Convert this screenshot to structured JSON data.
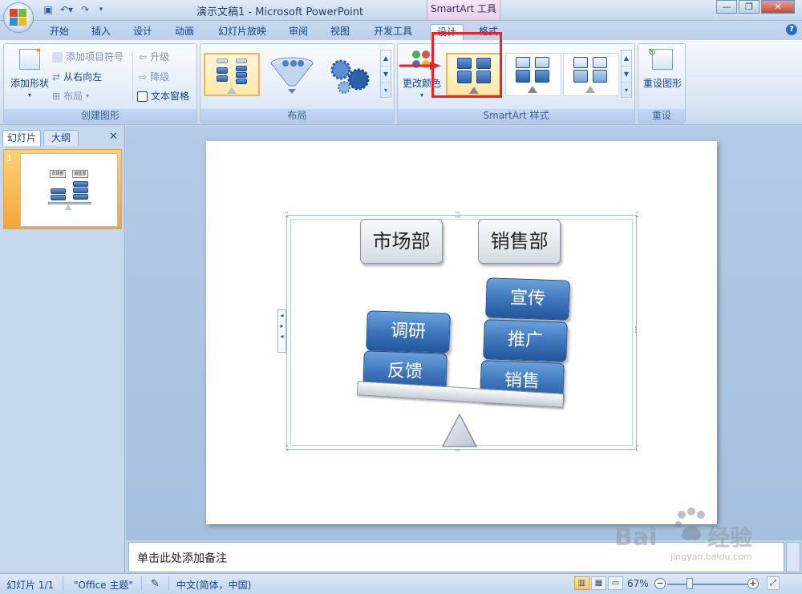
{
  "window": {
    "title": "演示文稿1 - Microsoft PowerPoint",
    "context_tab": "SmartArt 工具",
    "buttons": {
      "minimize": "—",
      "restore": "❐",
      "close": "✕"
    }
  },
  "qat": {
    "save_icon": "save-icon",
    "undo_icon": "undo-icon",
    "redo_icon": "redo-icon"
  },
  "tabs": [
    "开始",
    "插入",
    "设计",
    "动画",
    "幻灯片放映",
    "审阅",
    "视图",
    "开发工具",
    "设计",
    "格式"
  ],
  "active_tab_index": 8,
  "ribbon": {
    "create_group": {
      "label": "创建图形",
      "add_shape": "添加形状",
      "add_bullet": "添加项目符号",
      "right_to_left": "从右向左",
      "layout": "布局",
      "promote": "升级",
      "demote": "降级",
      "text_pane": "文本窗格"
    },
    "layouts_group": {
      "label": "布局"
    },
    "styles_group": {
      "label": "SmartArt 样式",
      "change_colors": "更改颜色"
    },
    "reset_group": {
      "label": "重设",
      "reset_graphic": "重设图形"
    }
  },
  "left_panel": {
    "tab_slides": "幻灯片",
    "tab_outline": "大纲",
    "close": "✕",
    "slide_number": "1"
  },
  "slide": {
    "left_head": "市场部",
    "right_head": "销售部",
    "left_items": [
      "调研",
      "反馈"
    ],
    "right_items": [
      "宣传",
      "推广",
      "销售"
    ]
  },
  "thumbnail": {
    "left_head": "市场部",
    "right_head": "销售部"
  },
  "notes": {
    "placeholder": "单击此处添加备注"
  },
  "status": {
    "slide": "幻灯片 1/1",
    "theme": "\"Office 主题\"",
    "language": "中文(简体，中国)",
    "zoom": "67%"
  },
  "colors": {
    "accent_blue": "#3f77bd",
    "highlight_red": "#e8232b",
    "ribbon_bg": "#dbe7f5"
  }
}
